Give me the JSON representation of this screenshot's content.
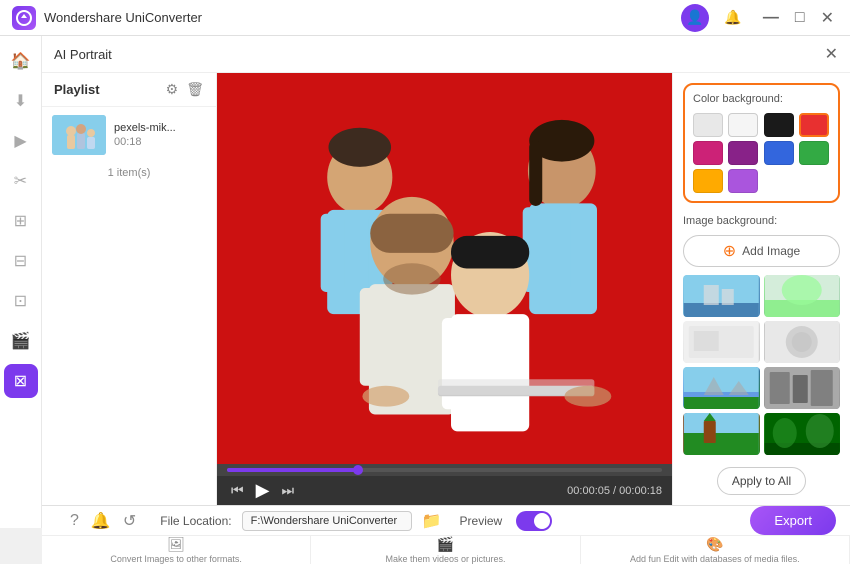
{
  "app": {
    "name": "Wondershare UniConverter",
    "logo_initial": "W"
  },
  "titlebar": {
    "icons": [
      "👤",
      "🔔"
    ],
    "controls": [
      "—",
      "□",
      "✕"
    ]
  },
  "sidebar": {
    "items": [
      {
        "icon": "⊞",
        "label": "home"
      },
      {
        "icon": "↓",
        "label": "download"
      },
      {
        "icon": "▶",
        "label": "convert"
      },
      {
        "icon": "✂",
        "label": "edit"
      },
      {
        "icon": "⊡",
        "label": "merge"
      },
      {
        "icon": "⊟",
        "label": "compress"
      },
      {
        "icon": "⊠",
        "label": "ai-portrait",
        "active": true
      }
    ]
  },
  "panel": {
    "title": "AI Portrait",
    "close_label": "✕"
  },
  "playlist": {
    "title": "Playlist",
    "items": [
      {
        "name": "pexels-mik...",
        "duration": "00:18"
      }
    ],
    "item_count": "1 item(s)"
  },
  "video": {
    "current_time": "00:00:05",
    "total_time": "00:00:18",
    "controls": {
      "prev": "◀◀",
      "play": "▶",
      "next": "▶▶"
    },
    "progress_percent": 30
  },
  "right_panel": {
    "color_bg": {
      "label": "Color background:",
      "colors": [
        {
          "hex": "#e8e8e8",
          "name": "light-gray"
        },
        {
          "hex": "#f0f0f0",
          "name": "white-gray"
        },
        {
          "hex": "#1a1a1a",
          "name": "black"
        },
        {
          "hex": "#e83030",
          "name": "red",
          "selected": true
        },
        {
          "hex": "#cc2277",
          "name": "pink"
        },
        {
          "hex": "#882288",
          "name": "purple"
        },
        {
          "hex": "#3366dd",
          "name": "blue"
        },
        {
          "hex": "#33aa44",
          "name": "green"
        },
        {
          "hex": "#ffaa00",
          "name": "orange"
        },
        {
          "hex": "#aa55dd",
          "name": "violet"
        }
      ]
    },
    "image_bg": {
      "label": "Image background:",
      "add_button": "Add Image",
      "thumbnails": [
        "city-skyline",
        "green-field",
        "white-room",
        "gray-circle",
        "mountain-lake",
        "urban-gray",
        "forest-path",
        "dark-green"
      ]
    },
    "apply_all": "Apply to All"
  },
  "bottom_bar": {
    "file_location_label": "File Location:",
    "file_path": "F:\\Wondershare UniConverter",
    "preview_label": "Preview",
    "export_label": "Export"
  },
  "bottom_strip": {
    "items": [
      {
        "icon": "⚙",
        "label": "Convert Images to other formats."
      },
      {
        "icon": "🖼",
        "label": "Make them videos or pictures."
      },
      {
        "icon": "🎨",
        "label": "Add fun Edit with databases of media files."
      }
    ]
  },
  "bottom_icons": [
    "?",
    "🔔",
    "↺"
  ]
}
